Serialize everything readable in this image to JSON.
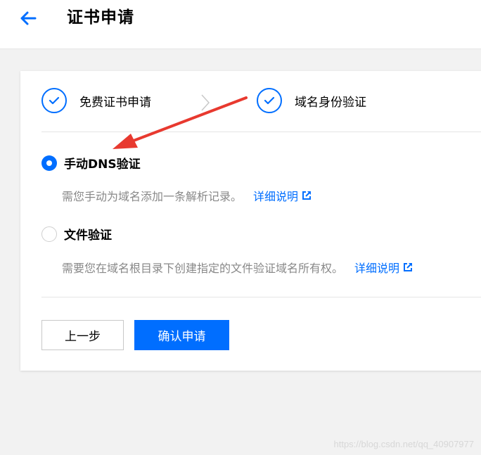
{
  "header": {
    "title": "证书申请",
    "back_icon": "arrow-left-icon"
  },
  "steps": [
    {
      "label": "免费证书申请",
      "status": "done"
    },
    {
      "label": "域名身份验证",
      "status": "done"
    }
  ],
  "options": [
    {
      "label": "手动DNS验证",
      "selected": true,
      "description": "需您手动为域名添加一条解析记录。",
      "link": "详细说明"
    },
    {
      "label": "文件验证",
      "selected": false,
      "description": "需要您在域名根目录下创建指定的文件验证域名所有权。",
      "link": "详细说明"
    }
  ],
  "buttons": {
    "prev": "上一步",
    "confirm": "确认申请"
  },
  "watermark": "https://blog.csdn.net/qq_40907977",
  "colors": {
    "accent": "#006eff",
    "annotation_arrow": "#e8392f"
  }
}
